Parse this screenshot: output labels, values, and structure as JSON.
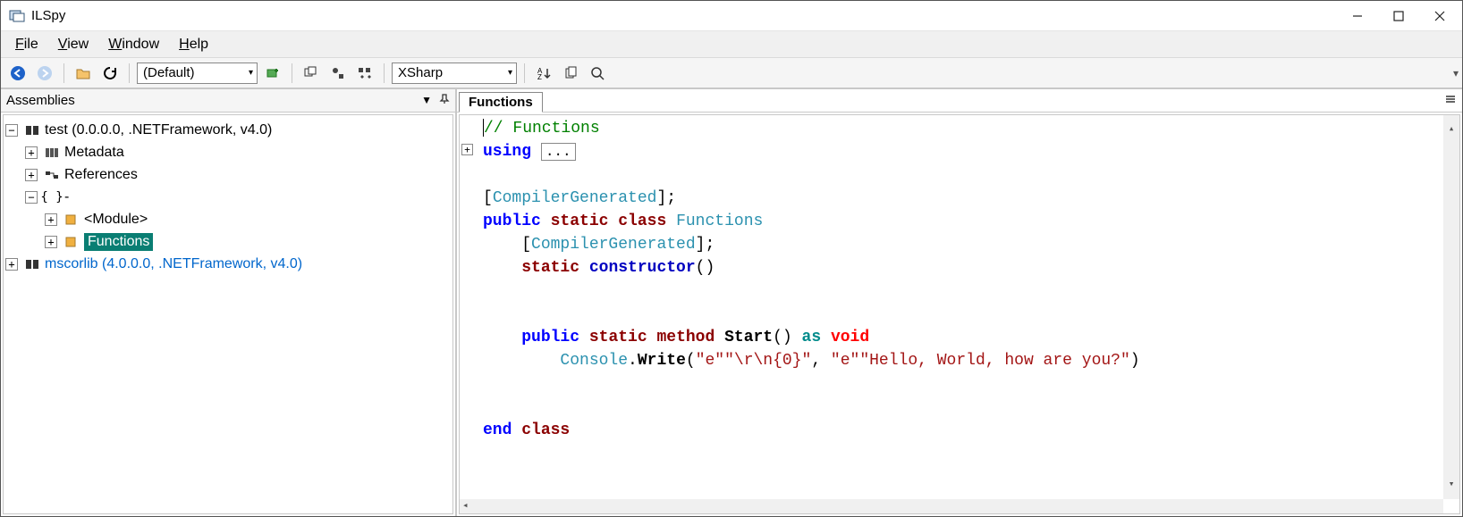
{
  "window": {
    "title": "ILSpy"
  },
  "menubar": {
    "file": "File",
    "view": "View",
    "window": "Window",
    "help": "Help"
  },
  "toolbar": {
    "combo1": "(Default)",
    "combo2": "XSharp"
  },
  "leftPane": {
    "title": "Assemblies"
  },
  "tree": {
    "root1": "test (0.0.0.0, .NETFramework, v4.0)",
    "metadata": "Metadata",
    "references": "References",
    "ns": "-",
    "module": "<Module>",
    "functions": "Functions",
    "root2": "mscorlib (4.0.0.0, .NETFramework, v4.0)"
  },
  "tabs": {
    "t0": "Functions"
  },
  "code": {
    "l1": "// Functions",
    "l2a": "using",
    "l2b": "...",
    "l4a": "CompilerGenerated",
    "l5a": "public",
    "l5b": "static",
    "l5c": "class",
    "l5d": "Functions",
    "l6a": "CompilerGenerated",
    "l7a": "static",
    "l7b": "constructor",
    "l10a": "public",
    "l10b": "static",
    "l10c": "method",
    "l10d": "Start",
    "l10e": "as",
    "l10f": "void",
    "l11a": "Console",
    "l11b": "Write",
    "l11s1": "\"e\"\"\\r\\n{0}\"",
    "l11s2": "\"e\"\"Hello, World, how are you?\"",
    "l14a": "end",
    "l14b": "class"
  }
}
